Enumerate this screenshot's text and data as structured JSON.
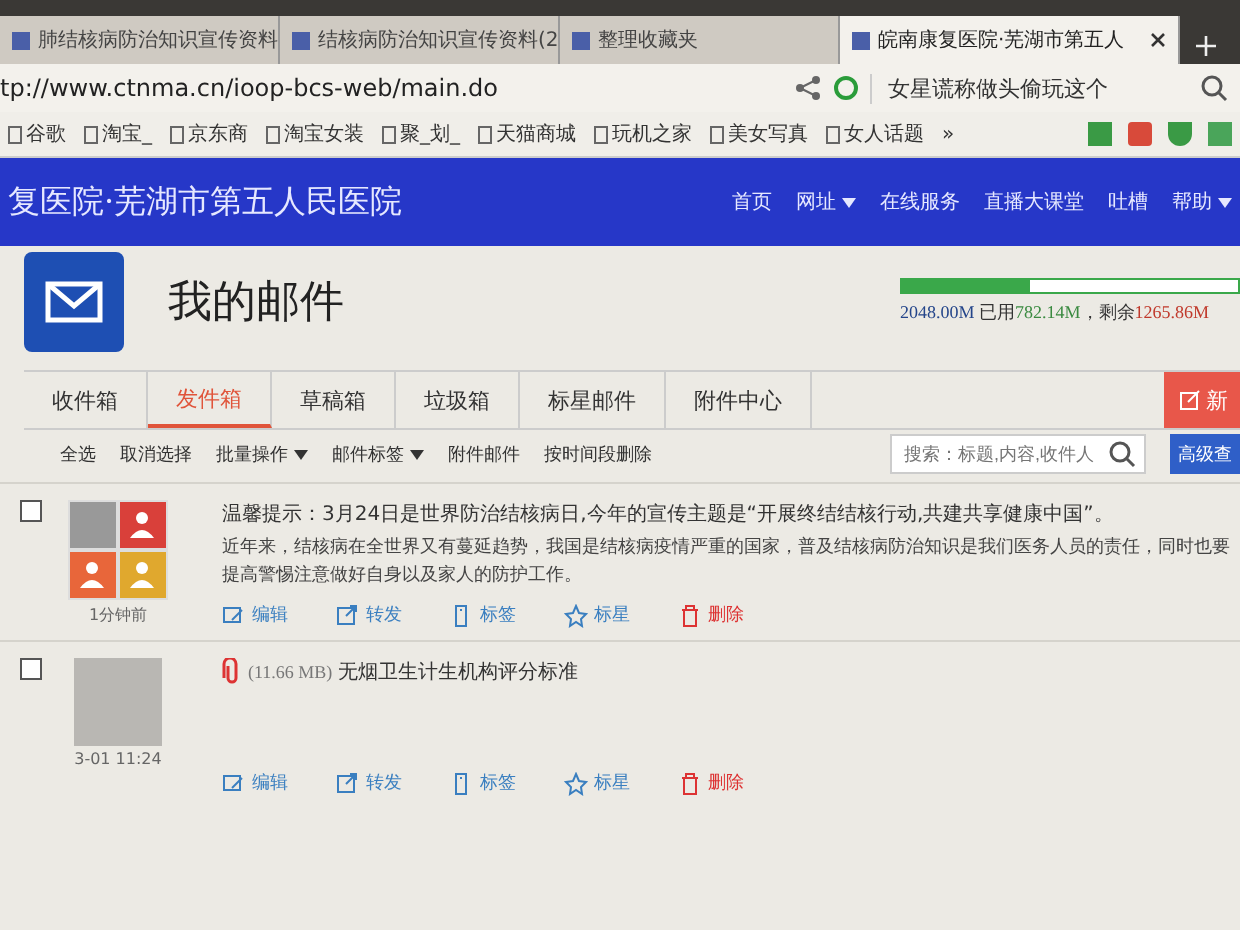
{
  "browser_tabs": [
    {
      "title": "肺结核病防治知识宣传资料",
      "selected": false
    },
    {
      "title": "结核病防治知识宣传资料(2",
      "selected": false
    },
    {
      "title": "整理收藏夹",
      "selected": false
    },
    {
      "title": "皖南康复医院·芜湖市第五人",
      "selected": true
    }
  ],
  "address_bar": {
    "url": "tp://www.ctnma.cn/ioop-bcs-web/main.do",
    "search_hint": "女星谎称做头偷玩这个"
  },
  "bookmarks": [
    "谷歌",
    "淘宝_",
    "京东商",
    "淘宝女装",
    "聚_划_",
    "天猫商城",
    "玩机之家",
    "美女写真",
    "女人话题"
  ],
  "bookmarks_more": "»",
  "site_header": {
    "title": "复医院·芜湖市第五人民医院",
    "nav": [
      {
        "label": "首页",
        "dropdown": false
      },
      {
        "label": "网址",
        "dropdown": true
      },
      {
        "label": "在线服务",
        "dropdown": false
      },
      {
        "label": "直播大课堂",
        "dropdown": false
      },
      {
        "label": "吐槽",
        "dropdown": false
      },
      {
        "label": "帮助",
        "dropdown": true
      }
    ]
  },
  "page_title": "我的邮件",
  "storage": {
    "level": 0.38,
    "total": "2048.00M",
    "used_label": "已用",
    "used": "782.14M",
    "remain_label": "，剩余",
    "remain": "1265.86M"
  },
  "mail_tabs": [
    {
      "label": "收件箱",
      "selected": false
    },
    {
      "label": "发件箱",
      "selected": true
    },
    {
      "label": "草稿箱",
      "selected": false
    },
    {
      "label": "垃圾箱",
      "selected": false
    },
    {
      "label": "标星邮件",
      "selected": false
    },
    {
      "label": "附件中心",
      "selected": false
    }
  ],
  "compose_button": "新",
  "toolbar": [
    {
      "label": "全选",
      "dropdown": false
    },
    {
      "label": "取消选择",
      "dropdown": false
    },
    {
      "label": "批量操作",
      "dropdown": true
    },
    {
      "label": "邮件标签",
      "dropdown": true
    },
    {
      "label": "附件邮件",
      "dropdown": false
    },
    {
      "label": "按时间段删除",
      "dropdown": false
    }
  ],
  "search": {
    "placeholder": "搜索：标题,内容,收件人",
    "advanced": "高级查"
  },
  "messages": [
    {
      "kind": "group",
      "checked": false,
      "time": "1分钟前",
      "subject": "温馨提示：3月24日是世界防治结核病日,今年的宣传主题是“开展终结结核行动,共建共享健康中国”。",
      "body": "近年来，结核病在全世界又有蔓延趋势，我国是结核病疫情严重的国家，普及结核病防治知识是我们医务人员的责任，同时也要提高警惕注意做好自身以及家人的防护工作。",
      "actions": [
        "编辑",
        "转发",
        "标签",
        "标星",
        "删除"
      ]
    },
    {
      "kind": "photo",
      "checked": false,
      "time": "3-01 11:24",
      "attachment_size": "(11.66 MB)",
      "subject": "无烟卫生计生机构评分标准",
      "actions": [
        "编辑",
        "转发",
        "标签",
        "标星",
        "删除"
      ]
    }
  ]
}
